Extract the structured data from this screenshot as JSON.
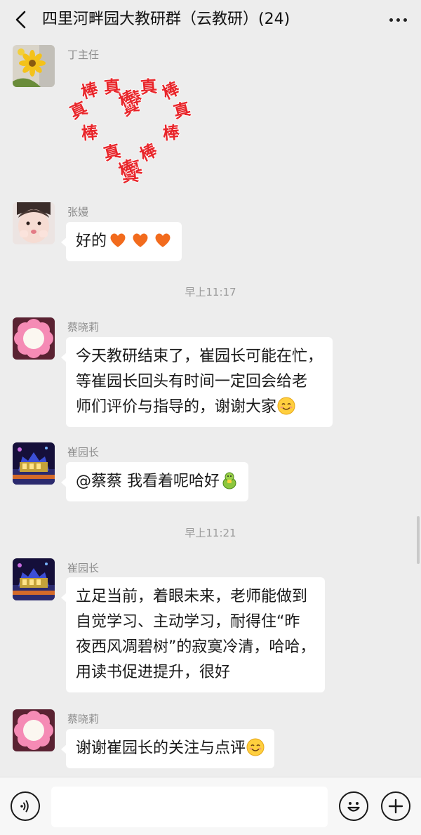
{
  "header": {
    "title": "四里河畔园大教研群（云教研）(24)",
    "back_icon": "chevron-left-icon",
    "more_icon": "more-dots-icon"
  },
  "messages": [
    {
      "sender": "丁主任",
      "type": "sticker",
      "sticker_chars": [
        "真",
        "棒",
        "真",
        "棒",
        "真",
        "棒",
        "棒",
        "真",
        "真",
        "棒",
        "真",
        "棒",
        "真",
        "棒",
        "真",
        "棒"
      ],
      "sticker_color": "#e8262b"
    },
    {
      "sender": "张嫚",
      "type": "text",
      "text": "好的",
      "emoji": [
        "heart-icon",
        "heart-icon",
        "heart-icon"
      ]
    },
    {
      "type": "time",
      "text": "早上11:17"
    },
    {
      "sender": "蔡晓莉",
      "type": "text",
      "lines": [
        "今天教研结束了，崔园长可能在忙，",
        "等崔园长回头有时间一定回会给老",
        "师们评价与指导的，谢谢大家"
      ],
      "emoji": [
        "smile-icon"
      ]
    },
    {
      "sender": "崔园长",
      "type": "text",
      "text": "@蔡蔡 我看着呢哈好",
      "emoji": [
        "thumbs-up-icon"
      ]
    },
    {
      "type": "time",
      "text": "早上11:21"
    },
    {
      "sender": "崔园长",
      "type": "text",
      "lines": [
        "立足当前，着眼未来，老师能做到",
        "自觉学习、主动学习，耐得住“昨",
        "夜西风凋碧树”的寂寞冷清，哈哈，",
        "用读书促进提升，很好"
      ]
    },
    {
      "sender": "蔡晓莉",
      "type": "text",
      "text": "谢谢崔园长的关注与点评",
      "emoji": [
        "smile-icon"
      ]
    }
  ],
  "input": {
    "value": "",
    "voice_icon": "voice-icon",
    "emoji_icon": "emoji-icon",
    "plus_icon": "plus-icon"
  },
  "colors": {
    "background": "#ededed",
    "bubble": "#ffffff",
    "sender": "#8c8c8c",
    "heart": "#f26b1d"
  }
}
